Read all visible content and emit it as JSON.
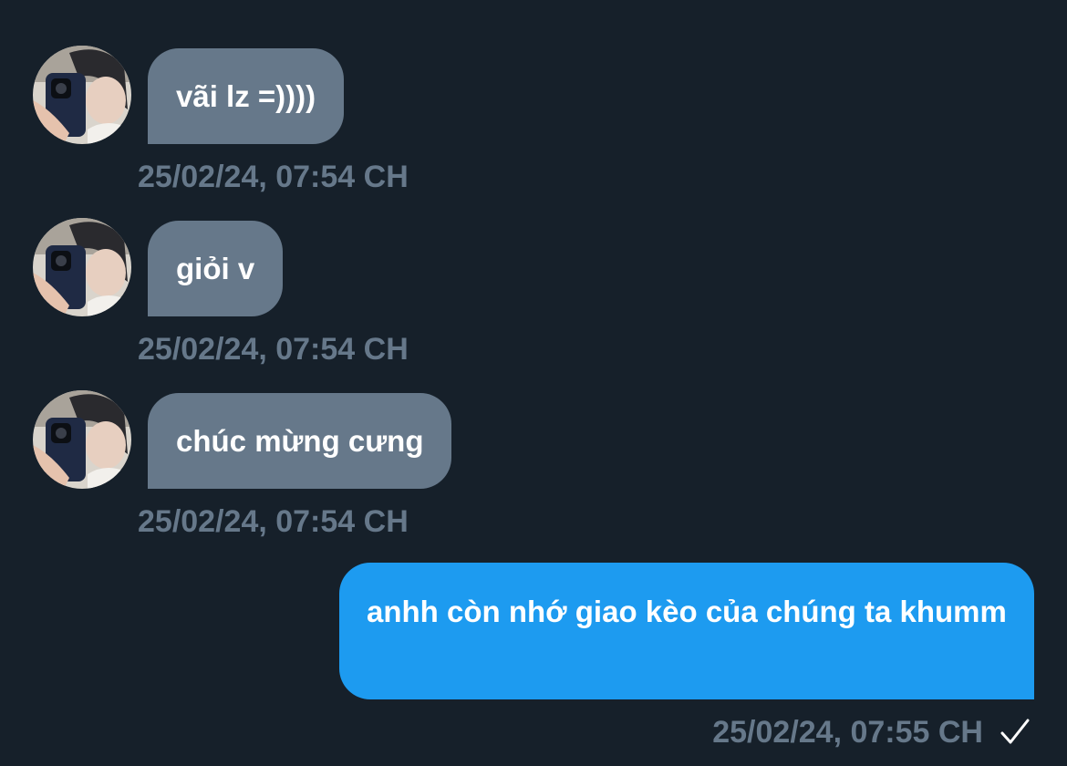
{
  "messages": [
    {
      "text": "vãi lz =))))",
      "time": "25/02/24, 07:54 CH",
      "sender": "other"
    },
    {
      "text": "giỏi v",
      "time": "25/02/24, 07:54 CH",
      "sender": "other"
    },
    {
      "text": "chúc mừng cưng",
      "time": "25/02/24, 07:54 CH",
      "sender": "other"
    },
    {
      "text": "anhh còn nhớ giao kèo của chúng ta khumm",
      "time": "25/02/24, 07:55 CH",
      "sender": "me",
      "status_icon": "check-icon"
    }
  ],
  "colors": {
    "background": "#16202a",
    "incoming_bubble": "#66788a",
    "outgoing_bubble": "#1d9bf0",
    "timestamp": "#66788a"
  }
}
